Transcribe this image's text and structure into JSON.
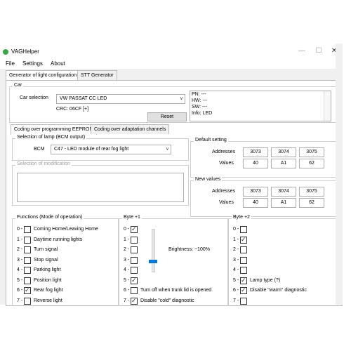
{
  "app": {
    "title": "VAGHelper",
    "icon": "app-icon"
  },
  "window_controls": {
    "minimize": "—",
    "maximize": "☐",
    "close": "✕"
  },
  "menu": [
    "File",
    "Settings",
    "About"
  ],
  "tabs": [
    {
      "label": "Generator of light configuration",
      "active": true
    },
    {
      "label": "STT Generator",
      "active": false
    }
  ],
  "car": {
    "group_title": "Car",
    "selection_label": "Car selection",
    "selection_value": "VW PASSAT CC LED",
    "crc": "CRC: 06CF [+]",
    "reset_label": "Reset",
    "info": [
      "PN: ---",
      "HW: ---",
      "SW: ---",
      "Info: LED"
    ]
  },
  "coding_tabs": [
    {
      "label": "Coding over programming EEPROM",
      "active": true
    },
    {
      "label": "Coding over adaptation channels",
      "active": false
    }
  ],
  "lamp": {
    "group_title": "Selection of lamp (BCM output)",
    "bcm_label": "BCM",
    "bcm_value": "C47 - LED module of rear fog light"
  },
  "modification": {
    "group_title": "Selection of modification"
  },
  "default_setting": {
    "group_title": "Default setting",
    "addresses_label": "Addresses",
    "values_label": "Values",
    "addresses": [
      "3073",
      "3074",
      "3075"
    ],
    "values": [
      "40",
      "A1",
      "62"
    ]
  },
  "new_values": {
    "group_title": "New values",
    "addresses_label": "Addresses",
    "values_label": "Values",
    "addresses": [
      "3073",
      "3074",
      "3075"
    ],
    "values": [
      "40",
      "A1",
      "62"
    ]
  },
  "functions": {
    "group_title": "Functions (Mode of operation)",
    "items": [
      {
        "num": "0 -",
        "label": "Coming Home/Leaving Home",
        "checked": false
      },
      {
        "num": "1 -",
        "label": "Daytime running lights",
        "checked": false
      },
      {
        "num": "2 -",
        "label": "Turn signal",
        "checked": false
      },
      {
        "num": "3 -",
        "label": "Stop signal",
        "checked": false
      },
      {
        "num": "4 -",
        "label": "Parking light",
        "checked": false
      },
      {
        "num": "5 -",
        "label": "Position light",
        "checked": false
      },
      {
        "num": "6 -",
        "label": "Rear fog light",
        "checked": true
      },
      {
        "num": "7 -",
        "label": "Reverse light",
        "checked": false
      }
    ]
  },
  "byte1": {
    "group_title": "Byte +1",
    "brightness": "Brightness: ~100%",
    "brightness_level": 1.0,
    "items": [
      {
        "num": "0 -",
        "label": "",
        "checked": true
      },
      {
        "num": "1 -",
        "label": "",
        "checked": false
      },
      {
        "num": "2 -",
        "label": "",
        "checked": false
      },
      {
        "num": "3 -",
        "label": "",
        "checked": false
      },
      {
        "num": "4 -",
        "label": "",
        "checked": false
      },
      {
        "num": "5 -",
        "label": "",
        "checked": true
      },
      {
        "num": "6 -",
        "label": "Turn off when trunk lid is opened",
        "checked": false
      },
      {
        "num": "7 -",
        "label": "Disable \"cold\" diagnostic",
        "checked": true
      }
    ]
  },
  "byte2": {
    "group_title": "Byte +2",
    "items": [
      {
        "num": "0 -",
        "label": "",
        "checked": false
      },
      {
        "num": "1 -",
        "label": "",
        "checked": true
      },
      {
        "num": "2 -",
        "label": "",
        "checked": false
      },
      {
        "num": "3 -",
        "label": "",
        "checked": false
      },
      {
        "num": "4 -",
        "label": "",
        "checked": false
      },
      {
        "num": "5 -",
        "label": "Lamp type (?)",
        "checked": true
      },
      {
        "num": "6 -",
        "label": "Disable \"warm\" diagnostic",
        "checked": true
      },
      {
        "num": "7 -",
        "label": "",
        "checked": false
      }
    ]
  }
}
